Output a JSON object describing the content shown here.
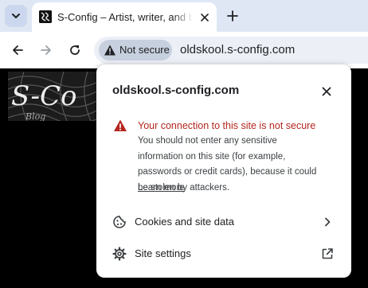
{
  "tab": {
    "title": "S-Config – Artist, writer, and blogger"
  },
  "omnibox": {
    "security_label": "Not secure",
    "url": "oldskool.s-config.com"
  },
  "popup": {
    "title": "oldskool.s-config.com",
    "warning_heading": "Your connection to this site is not secure",
    "warning_body": "You should not enter any sensitive information on this site (for example, passwords or credit cards), because it could be stolen by attackers.",
    "learn_more": "Learn more",
    "rows": [
      {
        "label": "Cookies and site data",
        "icon": "cookie-icon",
        "trail_icon": "chevron-right-icon"
      },
      {
        "label": "Site settings",
        "icon": "gear-icon",
        "trail_icon": "open-in-new-icon"
      }
    ]
  },
  "site_logo": {
    "title_text": "S-Config",
    "subtitle_text": "Blog"
  },
  "colors": {
    "tabstrip_bg": "#dfe7f5",
    "omnibox_bg": "#ecf0f6",
    "security_chip_bg": "#c7d0df",
    "warning_red": "#b3261e",
    "page_bg": "#000000"
  },
  "icons": {
    "tab_search": "chevron-down-icon",
    "tab_close": "close-icon",
    "new_tab": "plus-icon",
    "back": "arrow-left-icon",
    "forward": "arrow-right-icon",
    "reload": "reload-icon",
    "security": "warning-icon",
    "popup_close": "close-icon"
  }
}
